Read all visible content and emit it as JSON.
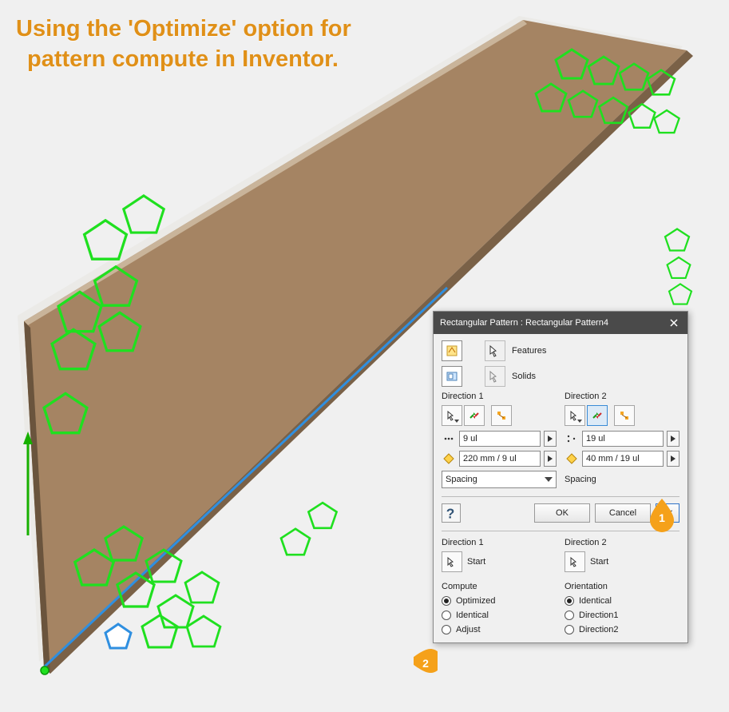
{
  "overlay": {
    "line1": "Using the 'Optimize' option for",
    "line2": "pattern compute in Inventor."
  },
  "dialog": {
    "title": "Rectangular Pattern : Rectangular Pattern4",
    "features_label": "Features",
    "solids_label": "Solids",
    "dir1": {
      "heading": "Direction 1",
      "count": "9 ul",
      "spacing_val": "220 mm / 9 ul",
      "spacing_mode": "Spacing"
    },
    "dir2": {
      "heading": "Direction 2",
      "count": "19 ul",
      "spacing_val": "40 mm / 19 ul",
      "spacing_mode": "Spacing"
    },
    "buttons": {
      "ok": "OK",
      "cancel": "Cancel",
      "collapse": "<<"
    },
    "lower": {
      "dir1_heading": "Direction 1",
      "dir2_heading": "Direction 2",
      "start_label": "Start",
      "compute_heading": "Compute",
      "compute_options": {
        "optimized": "Optimized",
        "identical": "Identical",
        "adjust": "Adjust"
      },
      "compute_selected": "optimized",
      "orientation_heading": "Orientation",
      "orientation_options": {
        "identical": "Identical",
        "direction1": "Direction1",
        "direction2": "Direction2"
      },
      "orientation_selected": "identical"
    }
  },
  "callouts": {
    "c1": "1",
    "c2": "2"
  }
}
